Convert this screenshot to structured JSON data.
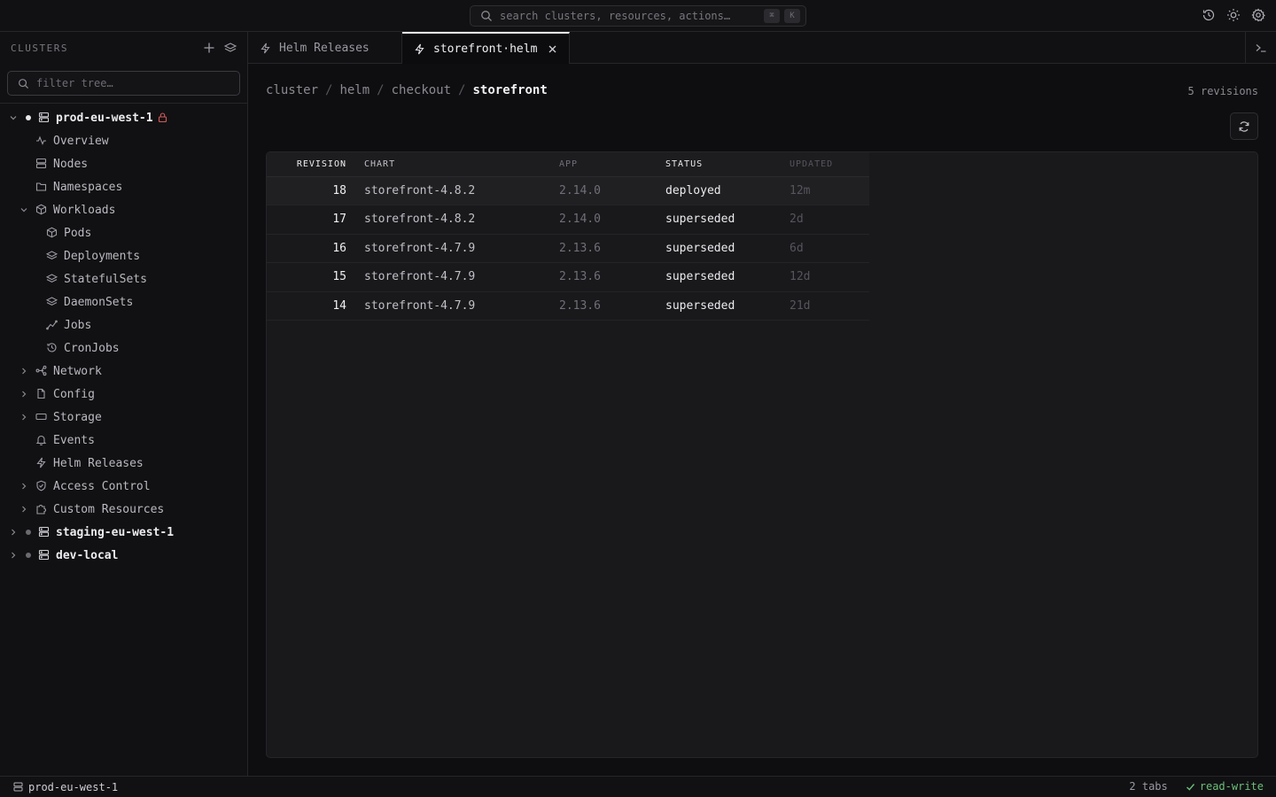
{
  "search": {
    "placeholder": "search clusters, resources, actions…",
    "kbd1": "⌘",
    "kbd2": "K"
  },
  "top_icons": [
    "history-icon",
    "sun-icon",
    "gear-icon"
  ],
  "sidebar": {
    "title": "CLUSTERS",
    "filter_placeholder": "filter tree…",
    "clusters": [
      {
        "name": "prod-eu-west-1",
        "expanded": true,
        "locked": true,
        "status_color": "#e8e8ec"
      },
      {
        "name": "staging-eu-west-1",
        "expanded": false,
        "status_color": "#6a6a70"
      },
      {
        "name": "dev-local",
        "expanded": false,
        "status_color": "#6a6a70"
      }
    ],
    "items": {
      "overview": "Overview",
      "nodes": "Nodes",
      "namespaces": "Namespaces",
      "workloads": "Workloads",
      "pods": "Pods",
      "deployments": "Deployments",
      "statefulsets": "StatefulSets",
      "daemonsets": "DaemonSets",
      "jobs": "Jobs",
      "cronjobs": "CronJobs",
      "network": "Network",
      "config": "Config",
      "storage": "Storage",
      "events": "Events",
      "helm_releases": "Helm Releases",
      "access_control": "Access Control",
      "custom_resources": "Custom Resources"
    }
  },
  "tabs": [
    {
      "label": "Helm Releases",
      "active": false
    },
    {
      "label": "storefront·helm",
      "active": true
    }
  ],
  "breadcrumb": [
    "cluster",
    "helm",
    "checkout",
    "storefront"
  ],
  "revision_count": "5 revisions",
  "table": {
    "columns": [
      "REVISION",
      "CHART",
      "APP",
      "STATUS",
      "UPDATED"
    ],
    "rows": [
      {
        "revision": "18",
        "chart": "storefront-4.8.2",
        "app": "2.14.0",
        "status": "deployed",
        "updated": "12m"
      },
      {
        "revision": "17",
        "chart": "storefront-4.8.2",
        "app": "2.14.0",
        "status": "superseded",
        "updated": "2d"
      },
      {
        "revision": "16",
        "chart": "storefront-4.7.9",
        "app": "2.13.6",
        "status": "superseded",
        "updated": "6d"
      },
      {
        "revision": "15",
        "chart": "storefront-4.7.9",
        "app": "2.13.6",
        "status": "superseded",
        "updated": "12d"
      },
      {
        "revision": "14",
        "chart": "storefront-4.7.9",
        "app": "2.13.6",
        "status": "superseded",
        "updated": "21d"
      }
    ]
  },
  "statusbar": {
    "cluster": "prod-eu-west-1",
    "tabs": "2 tabs",
    "mode": "read-write",
    "mode_color": "#6cbf7a"
  }
}
